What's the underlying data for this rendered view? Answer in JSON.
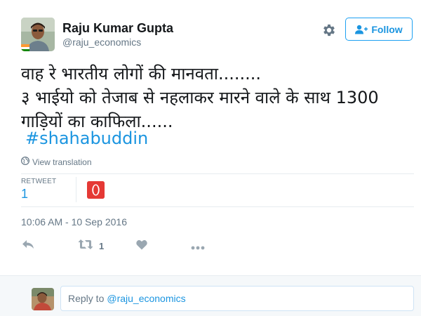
{
  "user": {
    "name": "Raju Kumar Gupta",
    "handle": "@raju_economics"
  },
  "follow_button": {
    "label": "Follow"
  },
  "tweet": {
    "lines": [
      "वाह रे भारतीय लोगों की मानवता........",
      "३ भाईयो को तेजाब से नहलाकर मारने वाले के साथ 1300",
      "गाड़ियों का काफिला......"
    ],
    "hashtag": "#shahabuddin"
  },
  "translation_link": "View translation",
  "stats": {
    "retweet_label": "RETWEET",
    "retweet_count": "1"
  },
  "timestamp": "10:06 AM - 10 Sep 2016",
  "actions": {
    "retweet_count": "1"
  },
  "reply": {
    "prefix": "Reply to",
    "mention": "@raju_economics"
  },
  "colors": {
    "accent": "#1da1f2",
    "link": "#1b95e0",
    "muted": "#657786",
    "retweeter_avatar": "#e53935"
  },
  "icons": {
    "settings": "gear-icon",
    "follow": "add-user-icon",
    "globe": "globe-icon",
    "reply": "reply-icon",
    "retweet": "retweet-icon",
    "like": "heart-icon",
    "more": "more-icon"
  }
}
